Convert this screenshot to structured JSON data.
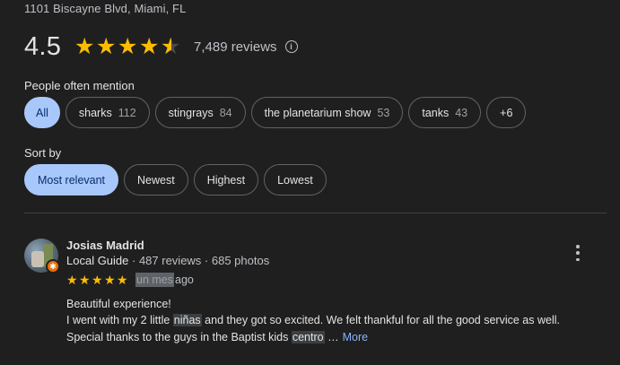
{
  "place": {
    "address": "1101 Biscayne Blvd, Miami, FL",
    "rating": "4.5",
    "rating_value": 4.5,
    "reviews_count": "7,489 reviews"
  },
  "mentions": {
    "label": "People often mention",
    "chips": [
      {
        "label": "All",
        "count": "",
        "active": true
      },
      {
        "label": "sharks",
        "count": "112"
      },
      {
        "label": "stingrays",
        "count": "84"
      },
      {
        "label": "the planetarium show",
        "count": "53"
      },
      {
        "label": "tanks",
        "count": "43"
      },
      {
        "label": "+6",
        "count": ""
      }
    ]
  },
  "sort": {
    "label": "Sort by",
    "options": [
      {
        "label": "Most relevant",
        "active": true
      },
      {
        "label": "Newest"
      },
      {
        "label": "Highest"
      },
      {
        "label": "Lowest"
      }
    ]
  },
  "review": {
    "name": "Josias Madrid",
    "guide": "Local Guide",
    "meta": " · 487 reviews · 685 photos",
    "badge": "✱",
    "stars": 5,
    "time_highlight": "un mes",
    "time_rest": "ago",
    "line1": "Beautiful experience!",
    "line2_a": "I went with my 2 little ",
    "line2_hl": "niñas",
    "line2_b": " and they got so excited. We felt thankful for all the good service as well.",
    "line3_a": "Special thanks to the guys in the Baptist kids ",
    "line3_hl": "centro",
    "line3_b": " …",
    "more": "More"
  },
  "colors": {
    "background": "#1f1f1f",
    "star": "#fbbc04",
    "active_chip": "#a8c7fa",
    "link": "#8ab4f8",
    "guide_badge": "#e8710a"
  },
  "icons": [
    "star-icon",
    "info-icon",
    "more-vert-icon",
    "local-guide-badge-icon"
  ]
}
